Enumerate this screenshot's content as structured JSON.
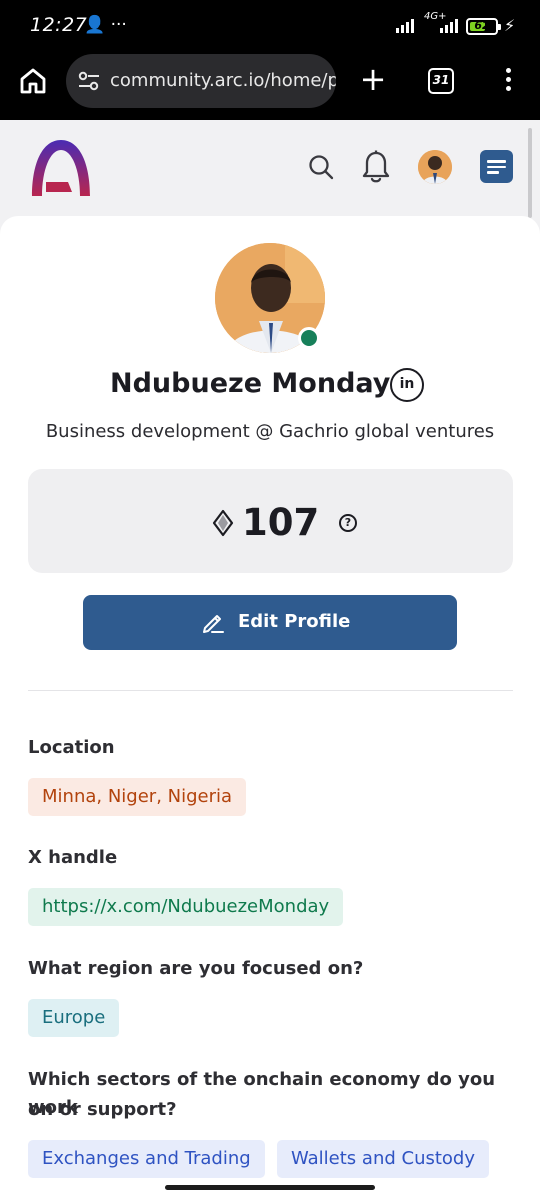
{
  "status_bar": {
    "time": "12:27",
    "left_icons": "👤 ···",
    "network": "4G+",
    "battery_percent": 62,
    "battery_label": "62"
  },
  "browser": {
    "url": "community.arc.io/home/pr",
    "tab_count": "31"
  },
  "header": {
    "icons": [
      "arc-logo-icon",
      "search-icon",
      "bell-icon",
      "avatar",
      "hamburger-menu-icon"
    ]
  },
  "profile": {
    "name": "Ndubueze Monday",
    "linkedin_label": "in",
    "headline": "Business development @ Gachrio global ventures",
    "points": "107",
    "help_label": "?",
    "edit_button": "Edit Profile",
    "online_status_color": "#17805a"
  },
  "fields": {
    "location": {
      "label": "Location",
      "value": "Minna, Niger, Nigeria"
    },
    "x_handle": {
      "label": "X handle",
      "value": "https://x.com/NdubuezeMonday"
    },
    "region": {
      "label": "What region are you focused on?",
      "value": "Europe"
    },
    "sectors": {
      "label_line1": "Which sectors of the onchain economy do you work",
      "label_line2": "on or support?",
      "values": [
        "Exchanges and Trading",
        "Wallets and Custody"
      ]
    }
  },
  "colors": {
    "accent": "#2f5b8f",
    "logo_top": "#4a2bb3",
    "logo_bottom": "#b8264f"
  }
}
